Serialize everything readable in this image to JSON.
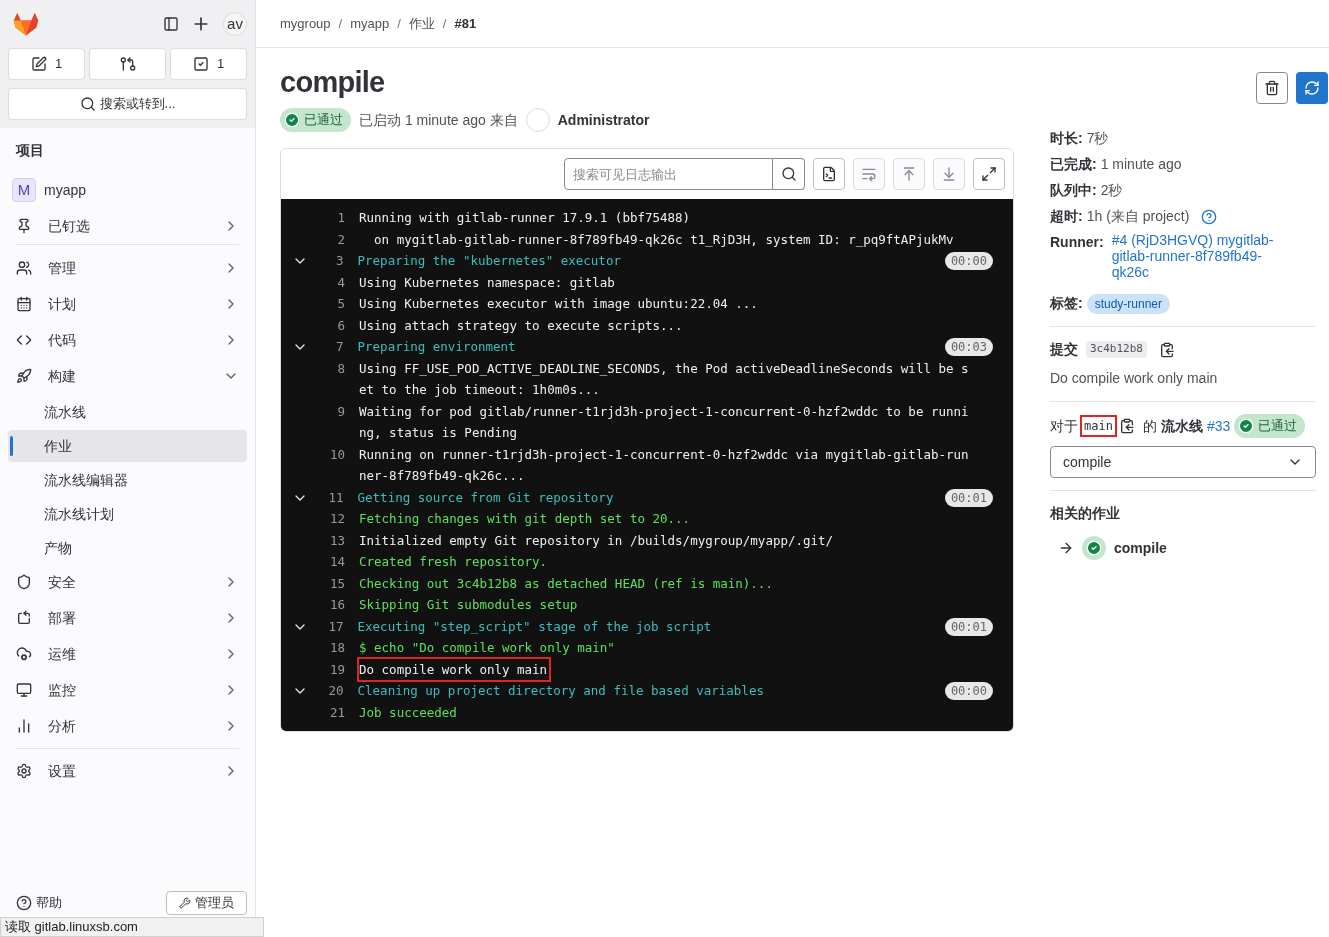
{
  "sidebar": {
    "issues_count": "1",
    "todos_count": "1",
    "avatar": "av",
    "search": "搜索或转到...",
    "section_title": "项目",
    "project": {
      "initial": "M",
      "name": "myapp"
    },
    "items": [
      {
        "label": "已钉选",
        "expanded": false
      },
      {
        "label": "管理",
        "expanded": false
      },
      {
        "label": "计划",
        "expanded": false
      },
      {
        "label": "代码",
        "expanded": false
      },
      {
        "label": "构建",
        "expanded": true,
        "children": [
          {
            "label": "流水线",
            "selected": false
          },
          {
            "label": "作业",
            "selected": true
          },
          {
            "label": "流水线编辑器",
            "selected": false
          },
          {
            "label": "流水线计划",
            "selected": false
          },
          {
            "label": "产物",
            "selected": false
          }
        ]
      },
      {
        "label": "安全",
        "expanded": false
      },
      {
        "label": "部署",
        "expanded": false
      },
      {
        "label": "运维",
        "expanded": false
      },
      {
        "label": "监控",
        "expanded": false
      },
      {
        "label": "分析",
        "expanded": false
      }
    ],
    "settings": {
      "label": "设置",
      "expanded": false
    },
    "help": "帮助",
    "admin": "管理员"
  },
  "status_bar": "读取 gitlab.linuxsb.com",
  "breadcrumb": [
    "mygroup",
    "myapp",
    "作业",
    "#81"
  ],
  "breadcrumb_separator": "/",
  "job": {
    "title": "compile",
    "status": "已通过",
    "started": "已启动 1 minute ago 来自",
    "user": "Administrator"
  },
  "log": {
    "search_placeholder": "搜索可见日志输出",
    "lines": [
      {
        "n": "1",
        "kind": "plain",
        "text": "Running with gitlab-runner 17.9.1 (bbf75488)",
        "highlighted": false
      },
      {
        "n": "2",
        "kind": "plain",
        "text": "  on mygitlab-gitlab-runner-8f789fb49-qk26c t1_RjD3H, system ID: r_pq9ftAPjukMv",
        "highlighted": false
      },
      {
        "n": "3",
        "kind": "section",
        "text": "Preparing the \"kubernetes\" executor",
        "duration": "00:00",
        "expanded": true,
        "highlighted": false
      },
      {
        "n": "4",
        "kind": "plain",
        "text": "Using Kubernetes namespace: gitlab",
        "highlighted": false
      },
      {
        "n": "5",
        "kind": "plain",
        "text": "Using Kubernetes executor with image ubuntu:22.04 ...",
        "highlighted": false
      },
      {
        "n": "6",
        "kind": "plain",
        "text": "Using attach strategy to execute scripts...",
        "highlighted": false
      },
      {
        "n": "7",
        "kind": "section",
        "text": "Preparing environment",
        "duration": "00:03",
        "expanded": true,
        "highlighted": false
      },
      {
        "n": "8",
        "kind": "plain",
        "text": "Using FF_USE_POD_ACTIVE_DEADLINE_SECONDS, the Pod activeDeadlineSeconds will be set to the job timeout: 1h0m0s...",
        "highlighted": false
      },
      {
        "n": "9",
        "kind": "plain",
        "text": "Waiting for pod gitlab/runner-t1rjd3h-project-1-concurrent-0-hzf2wddc to be running, status is Pending",
        "highlighted": false
      },
      {
        "n": "10",
        "kind": "plain",
        "text": "Running on runner-t1rjd3h-project-1-concurrent-0-hzf2wddc via mygitlab-gitlab-runner-8f789fb49-qk26c...",
        "highlighted": false
      },
      {
        "n": "11",
        "kind": "section",
        "text": "Getting source from Git repository",
        "duration": "00:01",
        "expanded": true,
        "highlighted": false
      },
      {
        "n": "12",
        "kind": "success",
        "text": "Fetching changes with git depth set to 20...",
        "highlighted": false
      },
      {
        "n": "13",
        "kind": "plain",
        "text": "Initialized empty Git repository in /builds/mygroup/myapp/.git/",
        "highlighted": false
      },
      {
        "n": "14",
        "kind": "success",
        "text": "Created fresh repository.",
        "highlighted": false
      },
      {
        "n": "15",
        "kind": "success",
        "text": "Checking out 3c4b12b8 as detached HEAD (ref is main)...",
        "highlighted": false
      },
      {
        "n": "16",
        "kind": "success",
        "text": "Skipping Git submodules setup",
        "highlighted": false
      },
      {
        "n": "17",
        "kind": "section",
        "text": "Executing \"step_script\" stage of the job script",
        "duration": "00:01",
        "expanded": true,
        "highlighted": false
      },
      {
        "n": "18",
        "kind": "success",
        "text": "$ echo \"Do compile work only main\"",
        "highlighted": false
      },
      {
        "n": "19",
        "kind": "plain",
        "text": "Do compile work only main",
        "highlighted": true
      },
      {
        "n": "20",
        "kind": "section",
        "text": "Cleaning up project directory and file based variables",
        "duration": "00:00",
        "expanded": true,
        "highlighted": false
      },
      {
        "n": "21",
        "kind": "success",
        "text": "Job succeeded",
        "highlighted": false
      }
    ]
  },
  "details": {
    "rows": [
      {
        "label": "时长:",
        "value": "7秒"
      },
      {
        "label": "已完成:",
        "value": "1 minute ago"
      },
      {
        "label": "队列中:",
        "value": "2秒"
      },
      {
        "label": "超时:",
        "value": "1h (来自 project)"
      }
    ],
    "runner_label": "Runner:",
    "runner": "#4 (RjD3HGVQ) mygitlab-gitlab-runner-8f789fb49-qk26c",
    "tags_label": "标签:",
    "tags": [
      "study-runner"
    ],
    "commit_label": "提交",
    "commit_sha": "3c4b12b8",
    "commit_message": "Do compile work only main",
    "pipeline": {
      "prefix": "对于",
      "ref": "main",
      "ref_highlighted": true,
      "of": "的",
      "label": "流水线",
      "number": "#33",
      "status": "已通过"
    },
    "job_select": "compile",
    "related_title": "相关的作业",
    "related_jobs": [
      {
        "name": "compile"
      }
    ]
  }
}
